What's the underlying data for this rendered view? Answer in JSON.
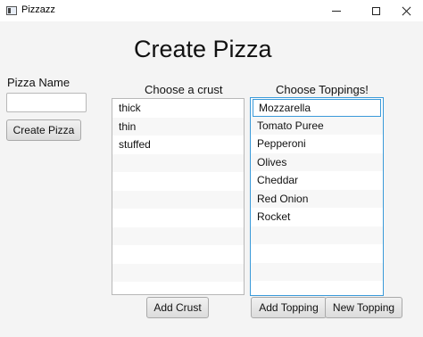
{
  "window": {
    "title": "Pizzazz",
    "icon": "app-window-icon"
  },
  "heading": "Create Pizza",
  "pizza_name": {
    "label": "Pizza Name",
    "value": ""
  },
  "buttons": {
    "create_pizza": "Create Pizza",
    "add_crust": "Add Crust",
    "add_topping": "Add Topping",
    "new_topping": "New Topping"
  },
  "crust": {
    "label": "Choose a crust",
    "items": [
      "thick",
      "thin",
      "stuffed"
    ]
  },
  "toppings": {
    "label": "Choose Toppings!",
    "items": [
      "Mozzarella",
      "Tomato Puree",
      "Pepperoni",
      "Olives",
      "Cheddar",
      "Red Onion",
      "Rocket"
    ],
    "selected_index": 0
  },
  "colors": {
    "focus": "#3a9ad9",
    "window_bg": "#f4f4f4"
  }
}
